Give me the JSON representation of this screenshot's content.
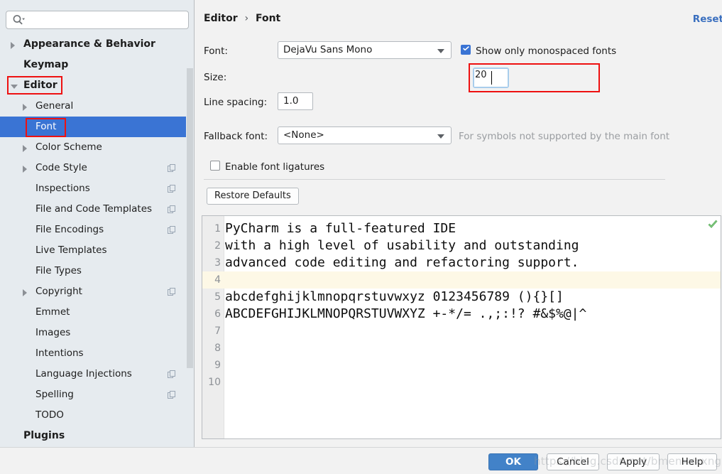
{
  "search": {
    "value": "",
    "placeholder": ""
  },
  "sidebar": {
    "items": [
      {
        "label": "Appearance & Behavior",
        "level": 0,
        "arrow": "right",
        "bold": true,
        "selected": false,
        "copy": false
      },
      {
        "label": "Keymap",
        "level": 0,
        "arrow": "none",
        "bold": true,
        "selected": false,
        "copy": false
      },
      {
        "label": "Editor",
        "level": 0,
        "arrow": "down",
        "bold": true,
        "selected": false,
        "copy": false
      },
      {
        "label": "General",
        "level": 1,
        "arrow": "right",
        "bold": false,
        "selected": false,
        "copy": false
      },
      {
        "label": "Font",
        "level": 1,
        "arrow": "none",
        "bold": false,
        "selected": true,
        "copy": false
      },
      {
        "label": "Color Scheme",
        "level": 1,
        "arrow": "right",
        "bold": false,
        "selected": false,
        "copy": false
      },
      {
        "label": "Code Style",
        "level": 1,
        "arrow": "right",
        "bold": false,
        "selected": false,
        "copy": true
      },
      {
        "label": "Inspections",
        "level": 1,
        "arrow": "none",
        "bold": false,
        "selected": false,
        "copy": true
      },
      {
        "label": "File and Code Templates",
        "level": 1,
        "arrow": "none",
        "bold": false,
        "selected": false,
        "copy": true
      },
      {
        "label": "File Encodings",
        "level": 1,
        "arrow": "none",
        "bold": false,
        "selected": false,
        "copy": true
      },
      {
        "label": "Live Templates",
        "level": 1,
        "arrow": "none",
        "bold": false,
        "selected": false,
        "copy": false
      },
      {
        "label": "File Types",
        "level": 1,
        "arrow": "none",
        "bold": false,
        "selected": false,
        "copy": false
      },
      {
        "label": "Copyright",
        "level": 1,
        "arrow": "right",
        "bold": false,
        "selected": false,
        "copy": true
      },
      {
        "label": "Emmet",
        "level": 1,
        "arrow": "none",
        "bold": false,
        "selected": false,
        "copy": false
      },
      {
        "label": "Images",
        "level": 1,
        "arrow": "none",
        "bold": false,
        "selected": false,
        "copy": false
      },
      {
        "label": "Intentions",
        "level": 1,
        "arrow": "none",
        "bold": false,
        "selected": false,
        "copy": false
      },
      {
        "label": "Language Injections",
        "level": 1,
        "arrow": "none",
        "bold": false,
        "selected": false,
        "copy": true
      },
      {
        "label": "Spelling",
        "level": 1,
        "arrow": "none",
        "bold": false,
        "selected": false,
        "copy": true
      },
      {
        "label": "TODO",
        "level": 1,
        "arrow": "none",
        "bold": false,
        "selected": false,
        "copy": false
      },
      {
        "label": "Plugins",
        "level": 0,
        "arrow": "none",
        "bold": true,
        "selected": false,
        "copy": false
      }
    ]
  },
  "header": {
    "breadcrumb_parent": "Editor",
    "breadcrumb_sep": "›",
    "breadcrumb_current": "Font",
    "reset_label": "Reset"
  },
  "form": {
    "font_label": "Font:",
    "font_value": "DejaVu Sans Mono",
    "monospaced_label": "Show only monospaced fonts",
    "monospaced_checked": true,
    "size_label": "Size:",
    "size_value": "20",
    "line_spacing_label": "Line spacing:",
    "line_spacing_value": "1.0",
    "fallback_label": "Fallback font:",
    "fallback_value": "<None>",
    "fallback_hint": "For symbols not supported by the main font",
    "ligatures_label": "Enable font ligatures",
    "ligatures_checked": false,
    "restore_defaults_label": "Restore Defaults"
  },
  "preview": {
    "lines": [
      {
        "number": "1",
        "text": "PyCharm is a full-featured IDE",
        "highlight": false
      },
      {
        "number": "2",
        "text": "with a high level of usability and outstanding",
        "highlight": false
      },
      {
        "number": "3",
        "text": "advanced code editing and refactoring support.",
        "highlight": false
      },
      {
        "number": "4",
        "text": "",
        "highlight": true
      },
      {
        "number": "5",
        "text": "abcdefghijklmnopqrstuvwxyz 0123456789 (){}[]",
        "highlight": false
      },
      {
        "number": "6",
        "text": "ABCDEFGHIJKLMNOPQRSTUVWXYZ +-*/= .,;:!? #&$%@|^",
        "highlight": false
      },
      {
        "number": "7",
        "text": "",
        "highlight": false
      },
      {
        "number": "8",
        "text": "",
        "highlight": false
      },
      {
        "number": "9",
        "text": "",
        "highlight": false
      },
      {
        "number": "10",
        "text": "",
        "highlight": false
      }
    ]
  },
  "footer": {
    "ok_label": "OK",
    "cancel_label": "Cancel",
    "apply_label": "Apply",
    "help_label": "Help"
  },
  "watermark": {
    "text": "https://blog.csdn.net/bmenxxxxng"
  },
  "colors": {
    "accent": "#3a74d4",
    "primary_button": "#4282c8",
    "link": "#3a6fbf",
    "sidebar_bg": "#e6ebef",
    "panel_bg": "#f2f2f2",
    "annotation": "#ee1111",
    "highlight_line": "#fdf8e6",
    "check_green": "#4ca64c"
  }
}
